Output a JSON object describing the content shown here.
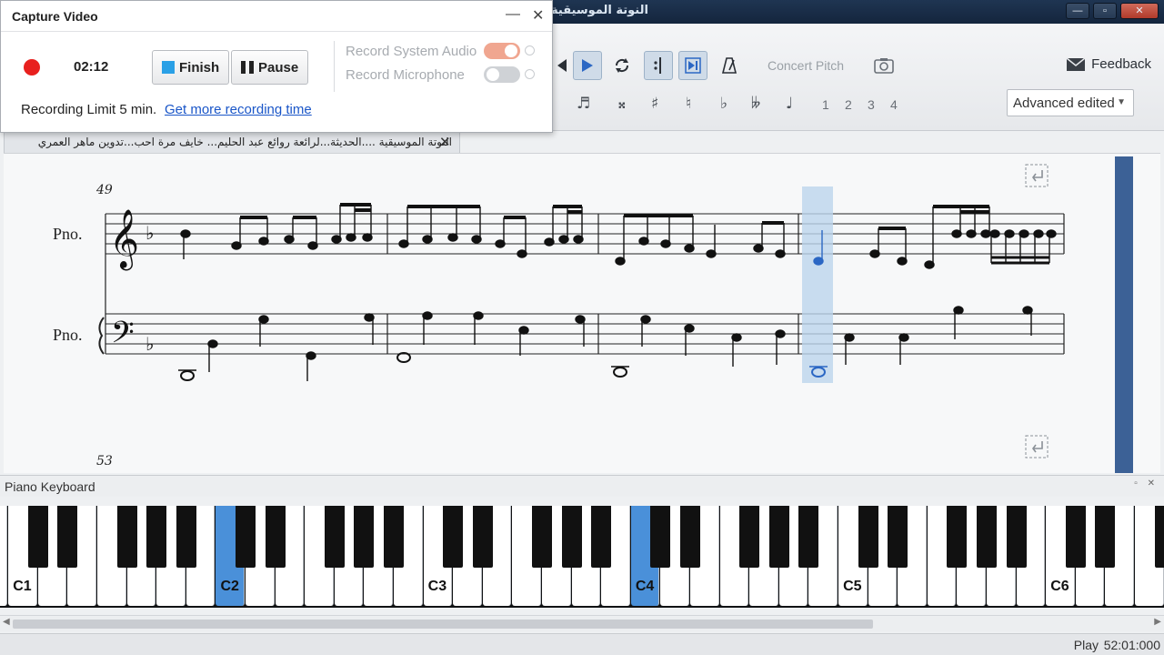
{
  "app": {
    "title": "النوتة الموسيقية",
    "window_min": "—",
    "window_max": "▫",
    "window_close": "✕"
  },
  "capture": {
    "title": "Capture Video",
    "minimize": "—",
    "close": "✕",
    "timer": "02:12",
    "finish_label": "Finish",
    "pause_label": "Pause",
    "record_system_audio": "Record System Audio",
    "record_microphone": "Record Microphone",
    "system_audio_on": true,
    "microphone_on": false,
    "limit_text": "Recording Limit 5 min.",
    "limit_link": "Get more recording time"
  },
  "toolbar": {
    "concert_pitch": "Concert Pitch",
    "feedback": "Feedback",
    "accidentals": [
      "♬",
      "𝄪",
      "♯",
      "♮",
      "♭",
      "𝄫",
      "♩"
    ],
    "voices": [
      "1",
      "2",
      "3",
      "4"
    ],
    "workspace": "Advanced edited"
  },
  "score": {
    "tab_title": "النوتة الموسيقية ....الحديثة...لرائعة روائع عبد الحليم... خايف مرة احب...تدوين ماهر العمري",
    "tab_close": "✕",
    "measure_start": "49",
    "next_measure": "53",
    "instrument_top": "Pno.",
    "instrument_bottom": "Pno."
  },
  "keyboard": {
    "title": "Piano Keyboard",
    "window_icons": "▫ ✕",
    "labels": [
      "C1",
      "C2",
      "C3",
      "C4",
      "C5",
      "C6"
    ],
    "pressed": [
      "C2",
      "C4"
    ]
  },
  "status": {
    "mode": "Play",
    "time": "52:01:000"
  },
  "colors": {
    "accent": "#4a90d9",
    "record": "#e8201e",
    "link": "#1a56c8",
    "selection": "#bcd4ec"
  }
}
